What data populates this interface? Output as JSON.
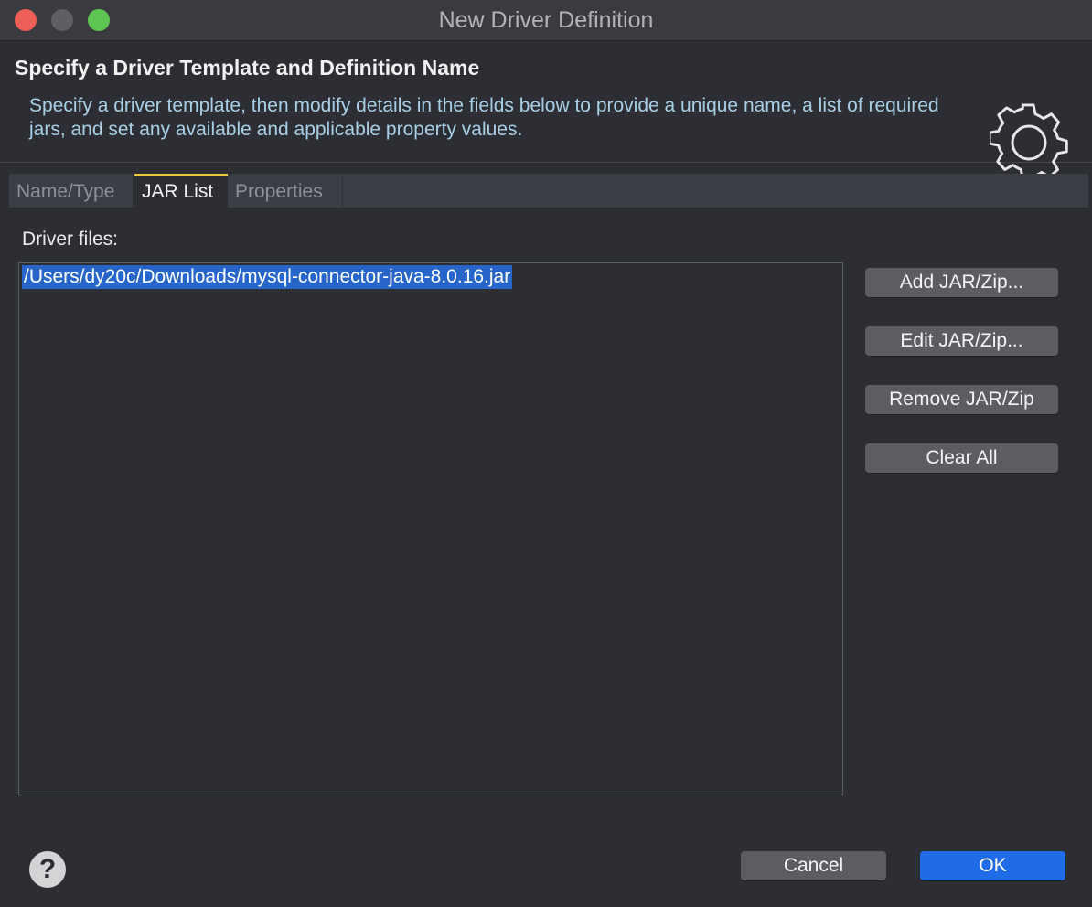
{
  "window": {
    "title": "New Driver Definition"
  },
  "banner": {
    "heading": "Specify a Driver Template and Definition Name",
    "description": "Specify a driver template, then modify details in the fields below to provide a unique name, a list of required jars, and set any available and applicable property values.",
    "icon": "gear-icon"
  },
  "tabs": [
    {
      "label": "Name/Type",
      "selected": false
    },
    {
      "label": "JAR List",
      "selected": true
    },
    {
      "label": "Properties",
      "selected": false
    }
  ],
  "jar_list": {
    "label": "Driver files:",
    "files": [
      "/Users/dy20c/Downloads/mysql-connector-java-8.0.16.jar"
    ],
    "buttons": {
      "add": "Add JAR/Zip...",
      "edit": "Edit JAR/Zip...",
      "remove": "Remove JAR/Zip",
      "clear": "Clear All"
    }
  },
  "footer": {
    "help_icon": "?",
    "cancel": "Cancel",
    "ok": "OK"
  },
  "colors": {
    "background": "#2c2e33",
    "accent_blue": "#1f6be8",
    "selection": "#2766c8",
    "tab_indicator": "#f0c83c"
  }
}
